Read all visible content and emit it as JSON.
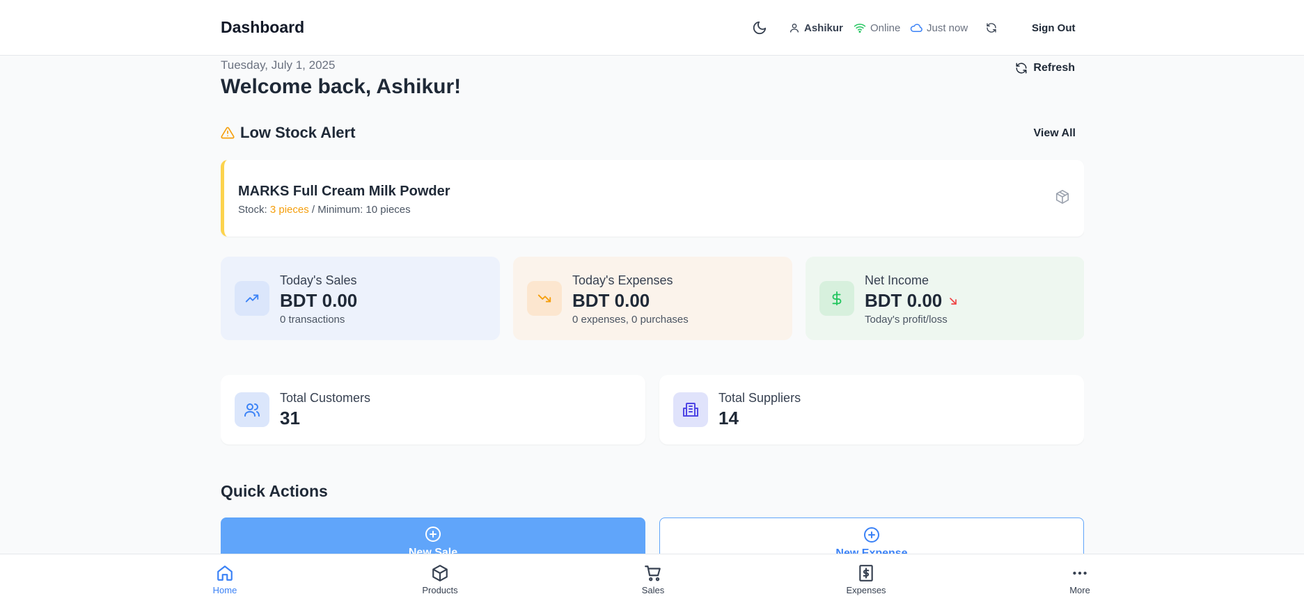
{
  "header": {
    "title": "Dashboard",
    "user": "Ashikur",
    "status": "Online",
    "sync": "Just now",
    "signout": "Sign Out"
  },
  "main": {
    "date": "Tuesday, July 1, 2025",
    "welcome": "Welcome back, Ashikur!",
    "refresh": "Refresh"
  },
  "low_stock": {
    "title": "Low Stock Alert",
    "view_all": "View All",
    "items": [
      {
        "name": "MARKS Full Cream Milk Powder",
        "stock_label": "Stock:",
        "stock_value": "3 pieces",
        "minimum_text": "/ Minimum: 10 pieces"
      }
    ]
  },
  "stats": [
    {
      "label": "Today's Sales",
      "value": "BDT 0.00",
      "sub": "0 transactions"
    },
    {
      "label": "Today's Expenses",
      "value": "BDT 0.00",
      "sub": "0 expenses, 0 purchases"
    },
    {
      "label": "Net Income",
      "value": "BDT 0.00",
      "sub": "Today's profit/loss"
    }
  ],
  "counts": [
    {
      "label": "Total Customers",
      "value": "31"
    },
    {
      "label": "Total Suppliers",
      "value": "14"
    }
  ],
  "quick_actions": {
    "title": "Quick Actions",
    "buttons": [
      {
        "label": "New Sale"
      },
      {
        "label": "New Expense"
      }
    ]
  },
  "bottom_nav": [
    {
      "label": "Home",
      "icon": "home-icon",
      "active": true
    },
    {
      "label": "Products",
      "icon": "box-icon"
    },
    {
      "label": "Sales",
      "icon": "cart-icon"
    },
    {
      "label": "Expenses",
      "icon": "receipt-icon"
    },
    {
      "label": "More",
      "icon": "more-icon"
    }
  ],
  "colors": {
    "accent": "#3b82f6",
    "primary_button": "#60a5fa",
    "warning": "#f59e0b",
    "online": "#22c55e",
    "sales_bg": "#edf2fc",
    "expenses_bg": "#fbf3eb",
    "income_bg": "#eef7f0"
  }
}
